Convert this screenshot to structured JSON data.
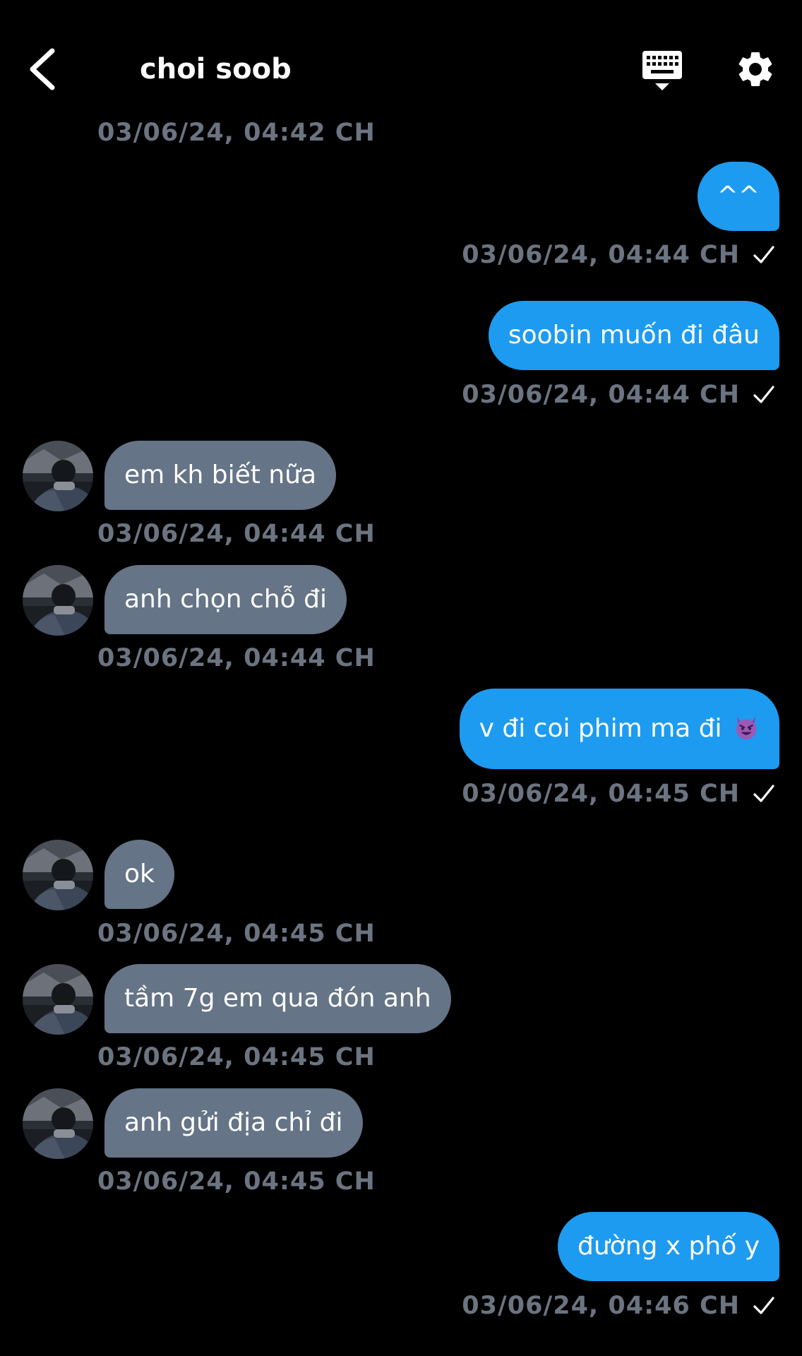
{
  "header": {
    "title": "choi soob",
    "back_icon": "chevron-left-icon",
    "keyboard_icon": "keyboard-icon",
    "settings_icon": "gear-icon"
  },
  "colors": {
    "background": "#000000",
    "outgoing_bubble": "#1d9bf0",
    "incoming_bubble": "#657486",
    "timestamp": "#6b7480"
  },
  "messages": [
    {
      "direction": "timestamp-only",
      "time": "03/06/24, 04:42 CH"
    },
    {
      "direction": "out",
      "text": "^^",
      "time": "03/06/24, 04:44 CH",
      "read": true
    },
    {
      "direction": "out",
      "text": "soobin muốn đi đâu",
      "time": "03/06/24, 04:44 CH",
      "read": true
    },
    {
      "direction": "in",
      "text": "em kh biết nữa",
      "time": "03/06/24, 04:44 CH"
    },
    {
      "direction": "in",
      "text": "anh chọn chỗ đi",
      "time": "03/06/24, 04:44 CH"
    },
    {
      "direction": "out",
      "text": "v đi coi phim ma đi",
      "emoji": "smiling-devil-emoji",
      "time": "03/06/24, 04:45 CH",
      "read": true
    },
    {
      "direction": "in",
      "text": "ok",
      "time": "03/06/24, 04:45 CH"
    },
    {
      "direction": "in",
      "text": "tầm 7g em qua đón anh",
      "time": "03/06/24, 04:45 CH"
    },
    {
      "direction": "in",
      "text": "anh gửi địa chỉ đi",
      "time": "03/06/24, 04:45 CH"
    },
    {
      "direction": "out",
      "text": "đường x phố y",
      "time": "03/06/24, 04:46 CH",
      "read": true
    }
  ]
}
